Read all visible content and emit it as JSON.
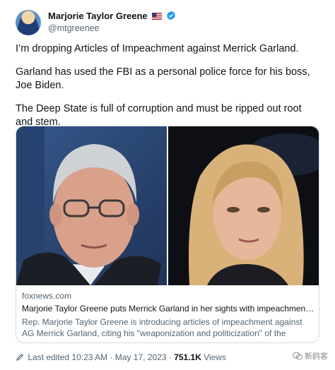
{
  "author": {
    "name": "Marjorie Taylor Greene",
    "handle": "@mtgreenee",
    "flag_icon": "us-flag-icon",
    "verified_icon": "verified-badge-icon",
    "verified_color": "#1d9bf0"
  },
  "tweet": {
    "paragraphs": [
      "I’m dropping Articles of Impeachment against Merrick Garland.",
      "Garland has used the FBI as a personal police force for his boss, Joe Biden.",
      "The Deep State is full of corruption and must be ripped out root and stem."
    ]
  },
  "card": {
    "domain": "foxnews.com",
    "title": "Marjorie Taylor Greene puts Merrick Garland in her sights with impeachment ...",
    "description": "Rep. Marjorie Taylor Greene is introducing articles of impeachment against AG Merrick Garland, citing his \"weaponization and politicization\" of the American..."
  },
  "footer": {
    "edit_label": "Last edited 10:23 AM",
    "separator": "·",
    "date": "May 17, 2023",
    "views_count": "751.1K",
    "views_label": "Views"
  },
  "watermark": {
    "text": "新鸥客"
  }
}
